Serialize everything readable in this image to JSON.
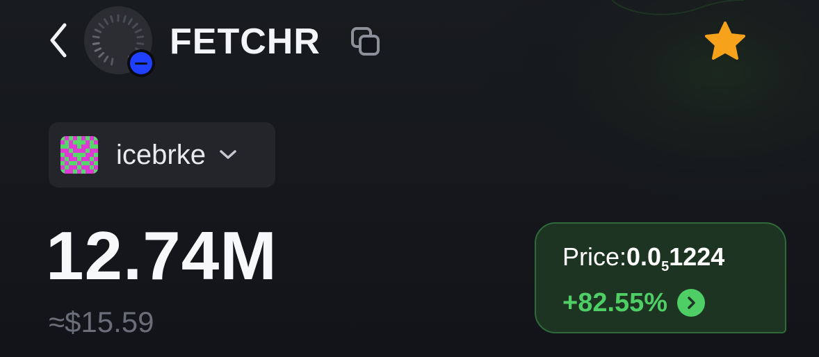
{
  "header": {
    "token_symbol": "FETCHR",
    "back_icon": "chevron-left-icon",
    "copy_icon": "copy-icon",
    "favorite_icon": "star-icon",
    "favorite_color": "#f7a21b",
    "chain_badge_color": "#1f40ff"
  },
  "account": {
    "name": "icebrke",
    "dropdown_icon": "chevron-down-icon"
  },
  "balance": {
    "amount": "12.74M",
    "usd_value": "≈$15.59"
  },
  "price_card": {
    "label": "Price:",
    "price_prefix": "0.0",
    "price_zero_count": "5",
    "price_digits": "1224",
    "change": "+82.55%",
    "change_color": "#4fce66",
    "go_icon": "chevron-right-circle-icon"
  }
}
